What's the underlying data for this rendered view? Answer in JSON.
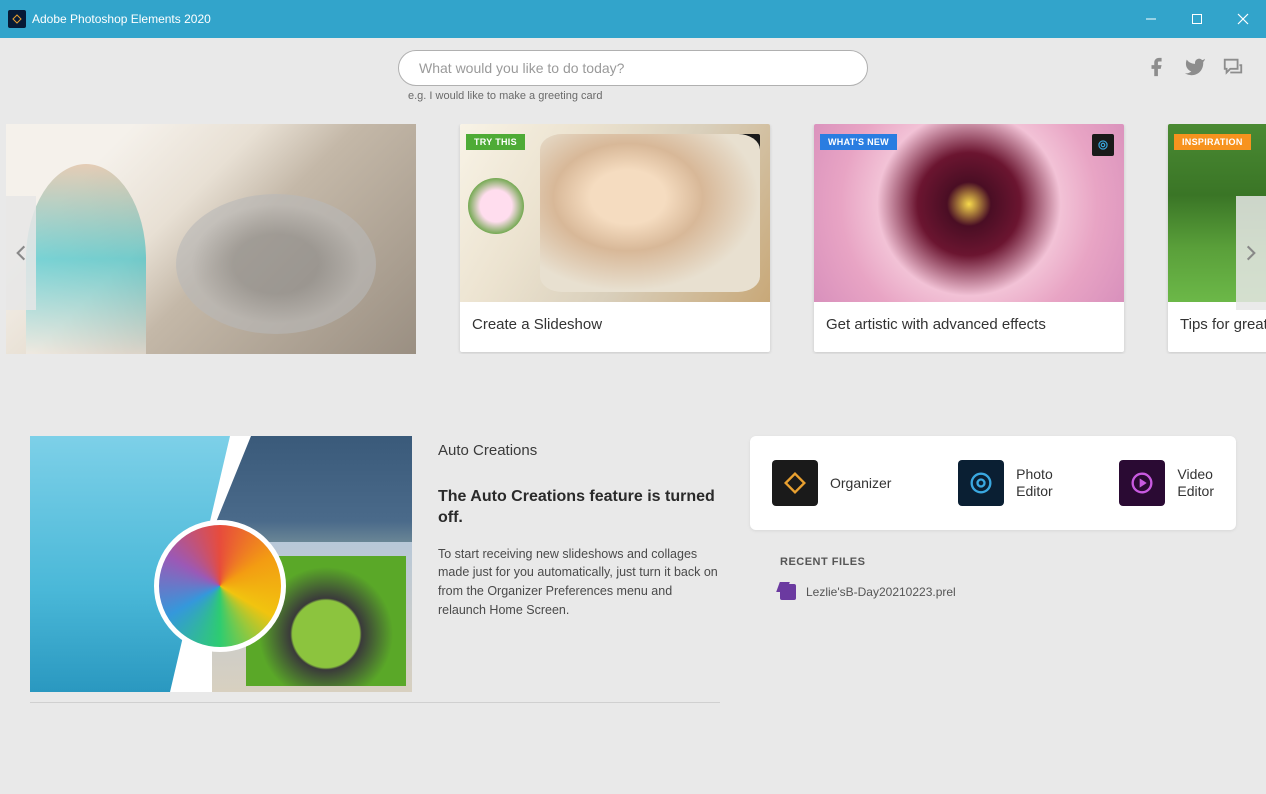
{
  "titlebar": {
    "app_title": "Adobe Photoshop Elements 2020"
  },
  "search": {
    "placeholder": "What would you like to do today?",
    "hint": "e.g. I would like to make a greeting card"
  },
  "cards": [
    {
      "title": "",
      "badge": "",
      "badge_type": "",
      "has_corner": false
    },
    {
      "title": "Create a Slideshow",
      "badge": "TRY THIS",
      "badge_type": "try",
      "has_corner": true
    },
    {
      "title": "Get artistic with advanced effects",
      "badge": "WHAT'S NEW",
      "badge_type": "new",
      "has_corner": true
    },
    {
      "title": "Tips for great",
      "badge": "INSPIRATION",
      "badge_type": "insp",
      "has_corner": false
    }
  ],
  "auto": {
    "heading": "Auto Creations",
    "sub": "The Auto Creations feature is turned off.",
    "body": "To start receiving new slideshows and collages made just for you automatically, just turn it back on from the Organizer Preferences menu and relaunch Home Screen."
  },
  "launch": {
    "organizer": "Organizer",
    "photo": "Photo\nEditor",
    "video": "Video\nEditor"
  },
  "recent": {
    "heading": "RECENT FILES",
    "items": [
      {
        "name": "Lezlie'sB-Day20210223.prel"
      }
    ]
  },
  "colors": {
    "titlebar": "#32a4cb",
    "badge_try": "#4eab36",
    "badge_new": "#2a7de1",
    "badge_insp": "#f7931e"
  }
}
